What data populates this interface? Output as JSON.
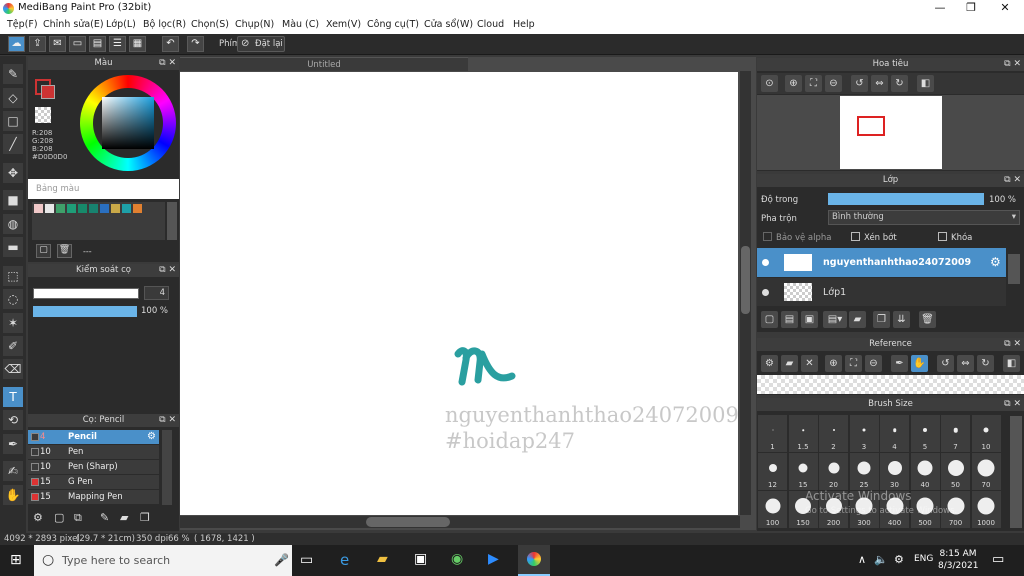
{
  "app": {
    "title": "MediBang Paint Pro (32bit)"
  },
  "window_controls": {
    "minimize": "—",
    "maximize": "❐",
    "close": "✕"
  },
  "menu": [
    "Tệp(F)",
    "Chỉnh sửa(E)",
    "Lớp(L)",
    "Bộ lọc(R)",
    "Chọn(S)",
    "Chụp(N)",
    "Màu (C)",
    "Xem(V)",
    "Công cụ(T)",
    "Cửa sổ(W)",
    "Cloud",
    "Help"
  ],
  "toolbar": {
    "key_label": "Phím",
    "reset_label": "Đặt lại"
  },
  "color_panel": {
    "title": "Màu",
    "r": "R:208",
    "g": "G:208",
    "b": "B:208",
    "hex": "#D0D0D0",
    "primary_color": "#d0d0d0",
    "palette_title": "Bảng màu",
    "palette_extra": "---",
    "swatches": [
      "#f0c8c8",
      "#e8e8e8",
      "#3fa06a",
      "#1f9e78",
      "#178a6a",
      "#18836f",
      "#2a6fbf",
      "#c8a848",
      "#1ea0a8",
      "#e08030"
    ]
  },
  "brush_control": {
    "title": "Kiểm soát cọ",
    "size_value": "4",
    "opacity_value": "100 %",
    "size_fraction": 0.95,
    "opacity_fraction": 1.0
  },
  "brush_list": {
    "title": "Cọ: Pencil",
    "items": [
      {
        "size": "4",
        "name": "Pencil",
        "selected": true,
        "color": "#3b3b3b"
      },
      {
        "size": "10",
        "name": "Pen",
        "selected": false,
        "color": "#3b3b3b"
      },
      {
        "size": "10",
        "name": "Pen (Sharp)",
        "selected": false,
        "color": "#3b3b3b"
      },
      {
        "size": "15",
        "name": "G Pen",
        "selected": false,
        "color": "#d33"
      },
      {
        "size": "15",
        "name": "Mapping Pen",
        "selected": false,
        "color": "#d33"
      }
    ]
  },
  "canvas": {
    "tab_title": "Untitled",
    "watermark_line1": "nguyenthanhthao24072009",
    "watermark_line2": "#hoidap247",
    "stroke_color": "#2a9fa0"
  },
  "navigator": {
    "title": "Hoa tiêu"
  },
  "layer_panel": {
    "title": "Lớp",
    "opacity_label": "Độ trong",
    "opacity_value": "100 %",
    "blend_label": "Pha trộn",
    "blend_value": "Bình thường",
    "protect_alpha": "Bảo vệ alpha",
    "clipping": "Xén bớt",
    "lock": "Khóa",
    "layers": [
      {
        "name": "nguyenthanhthao24072009",
        "selected": true
      },
      {
        "name": "Lớp1",
        "selected": false
      }
    ]
  },
  "reference": {
    "title": "Reference"
  },
  "brush_size": {
    "title": "Brush Size",
    "sizes": [
      "1",
      "1.5",
      "2",
      "3",
      "4",
      "5",
      "7",
      "10",
      "12",
      "15",
      "20",
      "25",
      "30",
      "40",
      "50",
      "70",
      "100",
      "150",
      "200",
      "300",
      "400",
      "500",
      "700",
      "1000"
    ]
  },
  "activation": {
    "line1": "Activate Windows",
    "line2": "Go to Settings to activate Windows."
  },
  "status": {
    "dims": "4092 * 2893 pixel",
    "size": "(29.7 * 21cm)",
    "dpi": "350 dpi",
    "zoom": "66 %",
    "coords": "( 1678, 1421 )"
  },
  "taskbar": {
    "search_placeholder": "Type here to search",
    "lang": "ENG",
    "time": "8:15 AM",
    "date": "8/3/2021"
  }
}
